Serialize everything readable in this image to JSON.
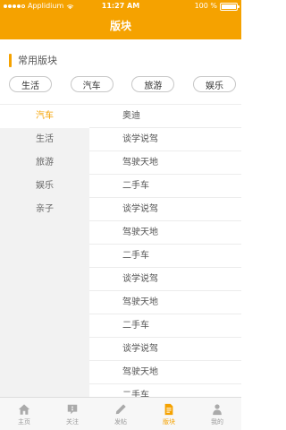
{
  "status_bar": {
    "carrier": "Applidium",
    "time": "11:27 AM",
    "battery": "100 %"
  },
  "header": {
    "title": "版块"
  },
  "common": {
    "title": "常用版块",
    "pills": [
      "生活",
      "汽车",
      "旅游",
      "娱乐"
    ]
  },
  "left_menu": {
    "items": [
      "汽车",
      "生活",
      "旅游",
      "娱乐",
      "亲子"
    ]
  },
  "right_list": {
    "items": [
      "奥迪",
      "谈学说驾",
      "驾驶天地",
      "二手车",
      "谈学说驾",
      "驾驶天地",
      "二手车",
      "谈学说驾",
      "驾驶天地",
      "二手车",
      "谈学说驾",
      "驾驶天地",
      "二手车"
    ]
  },
  "tabbar": {
    "tabs": [
      {
        "label": "主页",
        "icon": "home-icon"
      },
      {
        "label": "关注",
        "icon": "chat-icon"
      },
      {
        "label": "发帖",
        "icon": "pencil-icon"
      },
      {
        "label": "版块",
        "icon": "document-icon"
      },
      {
        "label": "我的",
        "icon": "person-icon"
      }
    ]
  },
  "colors": {
    "accent": "#f5a200",
    "menu_bg": "#f2f2f2"
  }
}
